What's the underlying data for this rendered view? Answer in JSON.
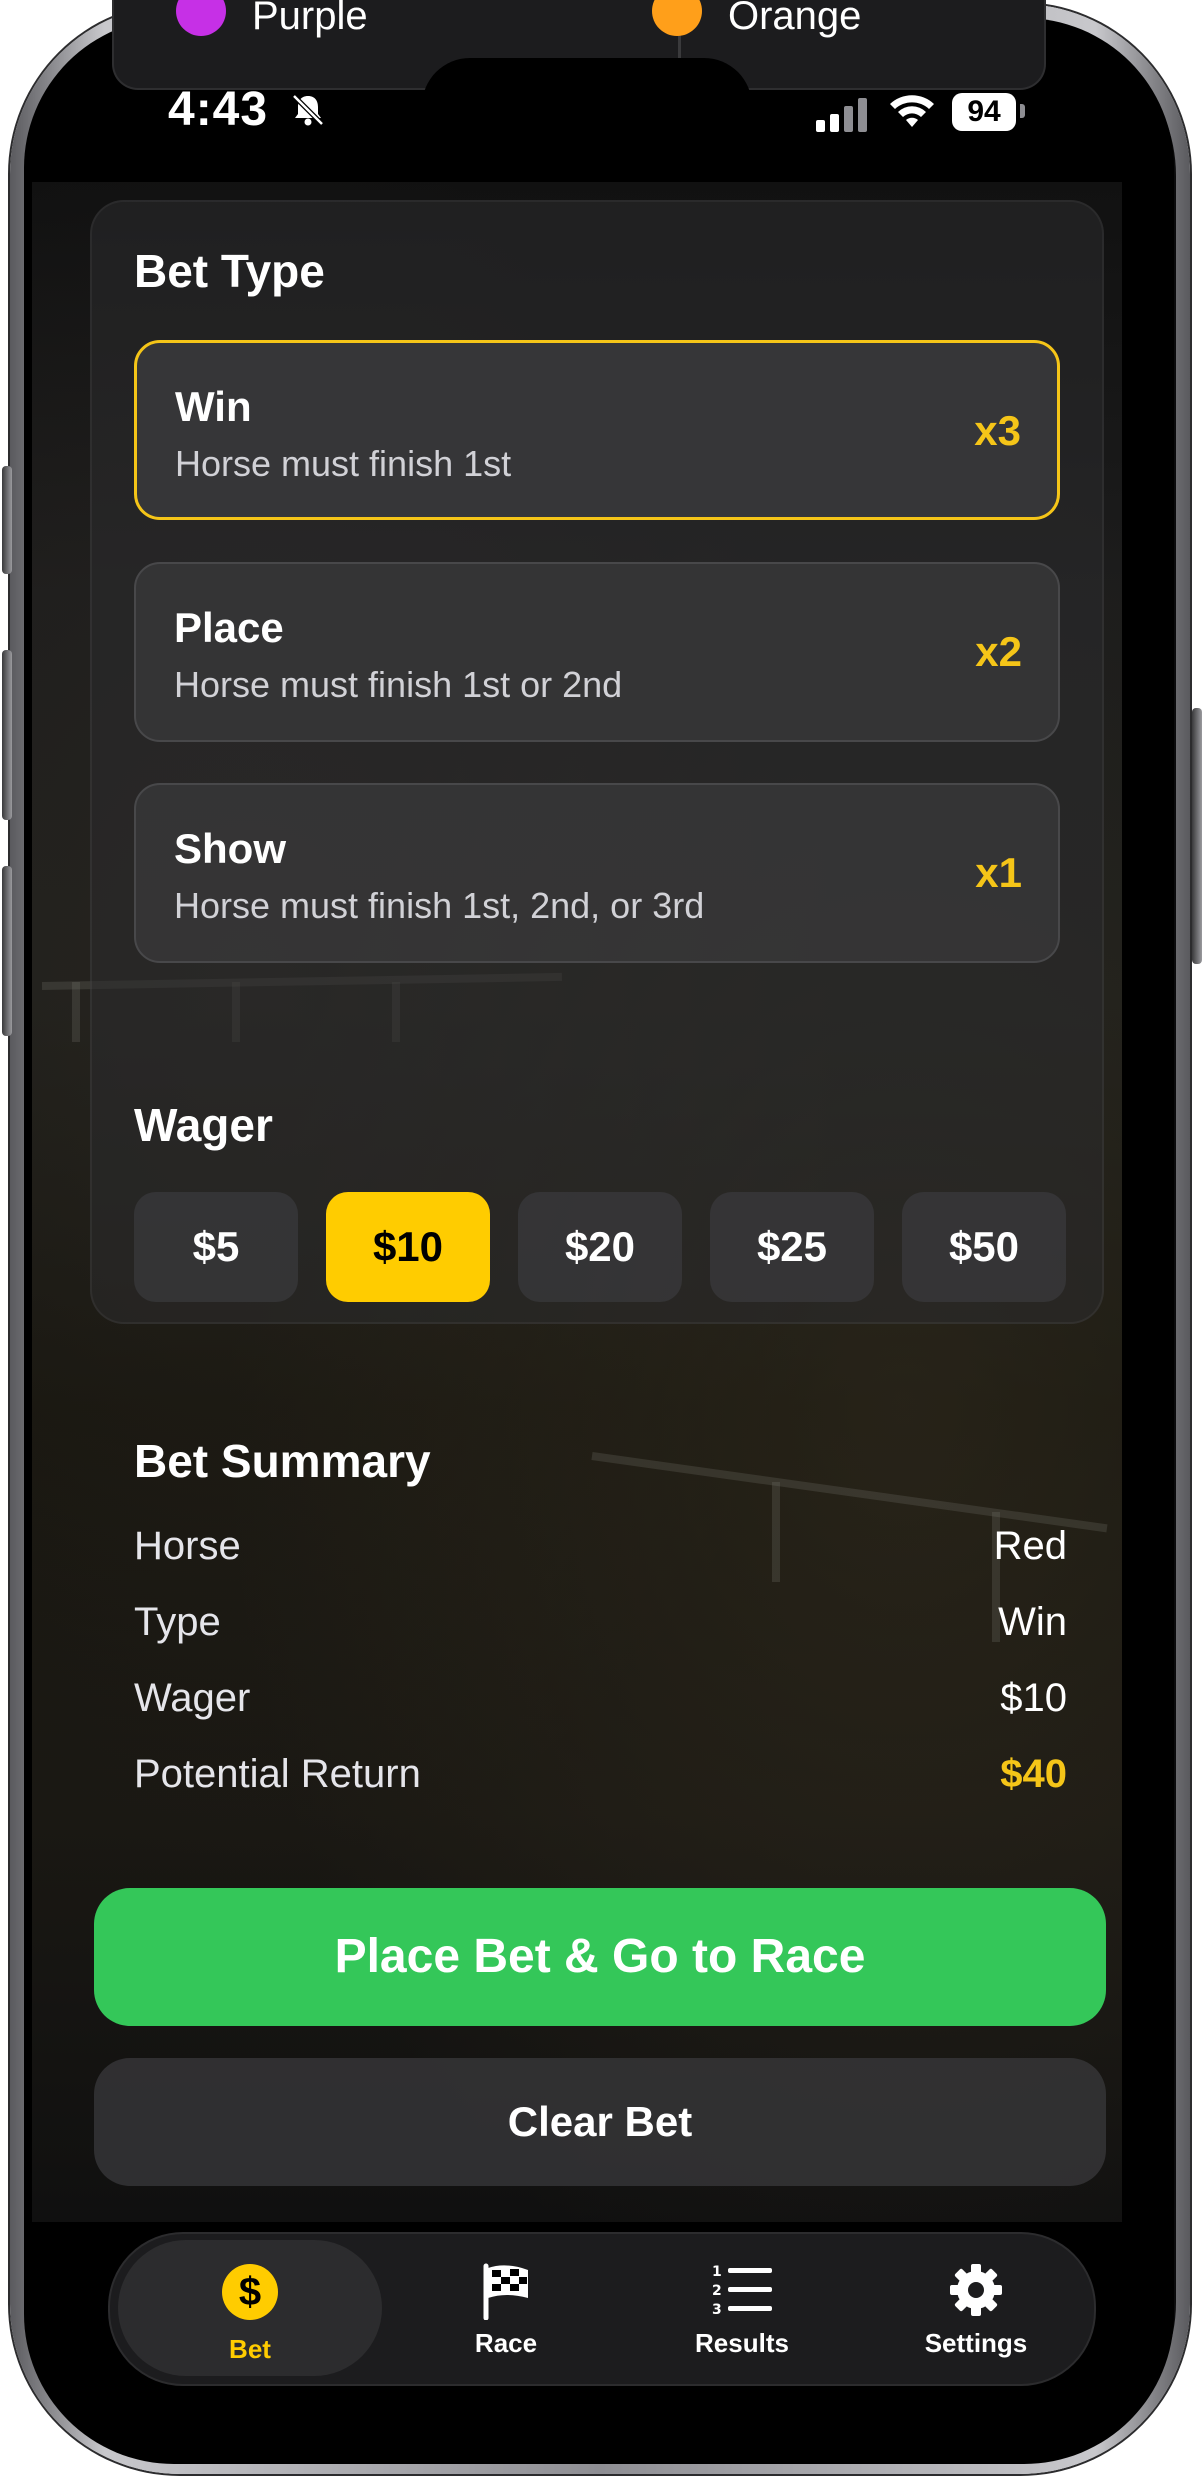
{
  "top_row": {
    "left_horse": {
      "name": "Purple",
      "color": "#c630e6"
    },
    "right_horse": {
      "name": "Orange",
      "color": "#ff9f1a"
    }
  },
  "status_bar": {
    "time": "4:43",
    "battery": "94"
  },
  "bet_type": {
    "title": "Bet Type",
    "options": [
      {
        "name": "Win",
        "description": "Horse must finish 1st",
        "multiplier": "x3",
        "selected": true
      },
      {
        "name": "Place",
        "description": "Horse must finish 1st or 2nd",
        "multiplier": "x2",
        "selected": false
      },
      {
        "name": "Show",
        "description": "Horse must finish 1st, 2nd, or 3rd",
        "multiplier": "x1",
        "selected": false
      }
    ]
  },
  "wager": {
    "title": "Wager",
    "amounts": [
      "$5",
      "$10",
      "$20",
      "$25",
      "$50"
    ],
    "selected": "$10"
  },
  "summary": {
    "title": "Bet Summary",
    "rows": [
      {
        "label": "Horse",
        "value": "Red"
      },
      {
        "label": "Type",
        "value": "Win"
      },
      {
        "label": "Wager",
        "value": "$10"
      },
      {
        "label": "Potential Return",
        "value": "$40"
      }
    ]
  },
  "actions": {
    "place_bet": "Place Bet & Go to Race",
    "clear_bet": "Clear Bet"
  },
  "tab_bar": {
    "tabs": [
      {
        "label": "Bet",
        "icon": "dollar-coin-icon",
        "active": true
      },
      {
        "label": "Race",
        "icon": "checkered-flag-icon",
        "active": false
      },
      {
        "label": "Results",
        "icon": "numbered-list-icon",
        "active": false
      },
      {
        "label": "Settings",
        "icon": "gear-icon",
        "active": false
      }
    ],
    "coin_symbol": "$"
  },
  "colors": {
    "accent": "#ffcc00",
    "primary_button": "#34c759",
    "active_tab_label": "#ffcc00"
  }
}
